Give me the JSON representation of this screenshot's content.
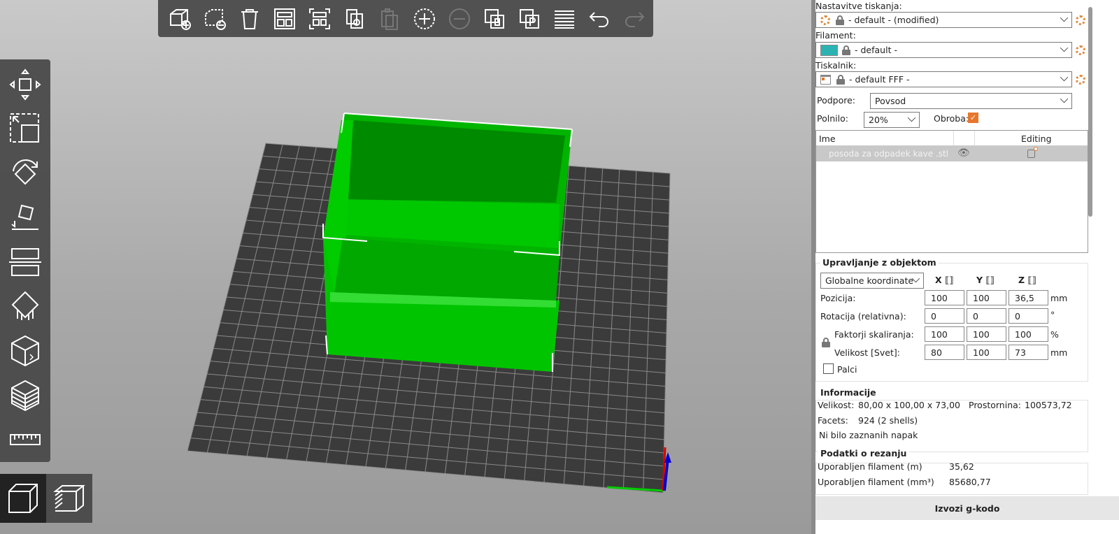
{
  "top_toolbar": [
    "add",
    "delete",
    "delete-all",
    "arrange",
    "arrange-selection",
    "copy",
    "paste",
    "add-instance",
    "remove-instance",
    "split-objects",
    "split-parts",
    "layers-editing",
    "undo",
    "redo"
  ],
  "left_toolbar": [
    "move",
    "scale",
    "rotate",
    "place-on-face",
    "cut",
    "supports",
    "seam",
    "variable-layer",
    "measure"
  ],
  "view_buttons": [
    "3d-view",
    "preview"
  ],
  "panel": {
    "print_settings_label": "Nastavitve tiskanja:",
    "print_settings_value": "- default - (modified)",
    "filament_label": "Filament:",
    "filament_value": "- default -",
    "filament_color": "#2bb3b3",
    "printer_label": "Tiskalnik:",
    "printer_value": "- default FFF -",
    "supports_label": "Podpore:",
    "supports_value": "Povsod",
    "infill_label": "Polnilo:",
    "infill_value": "20%",
    "brim_label": "Obroba:",
    "brim_checked": true,
    "accent": "#e8762c"
  },
  "object_list": {
    "col_name": "Ime",
    "col_editing": "Editing",
    "rows": [
      {
        "name": "posoda za odpadek kave .stl"
      }
    ]
  },
  "manipulation": {
    "title": "Upravljanje z objektom",
    "coord_system": "Globalne koordinate",
    "axes": [
      "X",
      "Y",
      "Z"
    ],
    "rows": [
      {
        "label": "Pozicija:",
        "values": [
          "100",
          "100",
          "36,5"
        ],
        "unit": "mm"
      },
      {
        "label": "Rotacija (relativna):",
        "values": [
          "0",
          "0",
          "0"
        ],
        "unit": "°"
      },
      {
        "label": "Faktorji skaliranja:",
        "values": [
          "100",
          "100",
          "100"
        ],
        "unit": "%"
      },
      {
        "label": "Velikost [Svet]:",
        "values": [
          "80",
          "100",
          "73"
        ],
        "unit": "mm"
      }
    ],
    "inches_label": "Palci"
  },
  "info": {
    "title": "Informacije",
    "size_label": "Velikost:",
    "size_value": "80,00 x 100,00 x 73,00",
    "volume_label": "Prostornina:",
    "volume_value": "100573,72",
    "facets_label": "Facets:",
    "facets_value": "924 (2 shells)",
    "errors": "Ni bilo zaznanih napak"
  },
  "slice": {
    "title": "Podatki o rezanju",
    "filament_m_label": "Uporabljen filament (m)",
    "filament_m_value": "35,62",
    "filament_mm3_label": "Uporabljen filament (mm³)",
    "filament_mm3_value": "85680,77"
  },
  "export_label": "Izvozi g-kodo"
}
